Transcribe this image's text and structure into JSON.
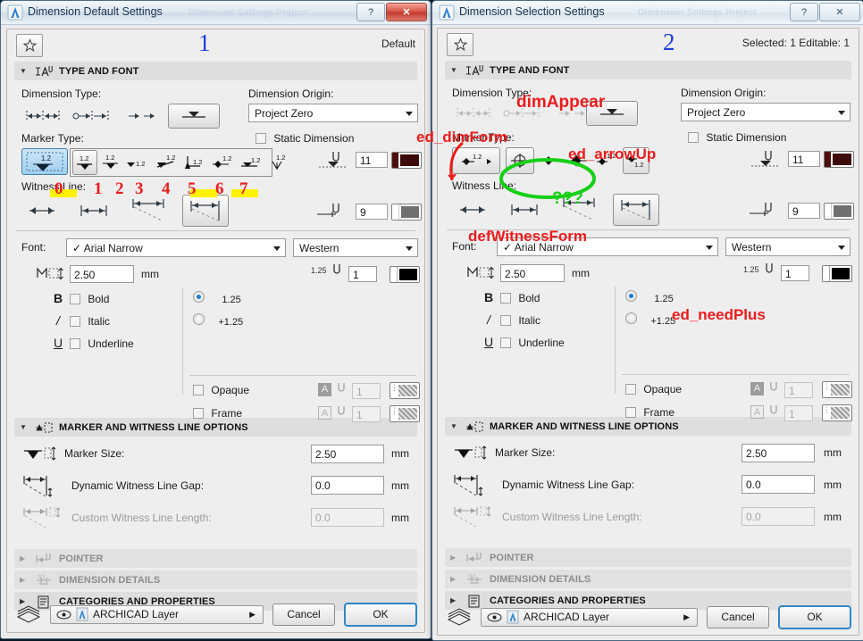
{
  "window1": {
    "title": "Dimension Default Settings",
    "ghost_title": "Dimension  Settings  Project",
    "help_btn": "?",
    "close_btn": "✕",
    "badge_number": "1",
    "status_right": "Default",
    "favorites_icon": "star-icon",
    "sections": {
      "type_and_font": "TYPE AND FONT",
      "marker_options": "MARKER AND WITNESS LINE OPTIONS",
      "pointer": "POINTER",
      "dimension_details": "DIMENSION DETAILS",
      "categories": "CATEGORIES AND PROPERTIES"
    },
    "labels": {
      "dimension_type": "Dimension Type:",
      "dimension_origin": "Dimension Origin:",
      "marker_type": "Marker Type:",
      "witness_line": "Witness Line:",
      "static_dimension": "Static Dimension",
      "font": "Font:",
      "bold": "Bold",
      "italic": "Italic",
      "underline": "Underline",
      "opaque": "Opaque",
      "frame": "Frame",
      "marker_size": "Marker Size:",
      "dynamic_gap": "Dynamic Witness Line Gap:",
      "custom_length": "Custom Witness Line Length:",
      "mm": "mm"
    },
    "values": {
      "dimension_origin": "Project Zero",
      "marker_pen": "11",
      "witness_pen": "9",
      "font_name": "Arial Narrow",
      "font_script": "Western",
      "font_size": "2.50",
      "font_pen": "1",
      "radio_plain": "1.25",
      "radio_plus": "+1.25",
      "opaque_pen": "1",
      "frame_pen": "1",
      "marker_size": "2.50",
      "dynamic_gap": "0.0",
      "custom_length": "0.0",
      "sup_125": "1.25"
    },
    "footer": {
      "layer": "ARCHICAD Layer",
      "cancel": "Cancel",
      "ok": "OK"
    },
    "annotations": {
      "marker_numbers": [
        "0",
        "1",
        "2",
        "3",
        "4",
        "5",
        "6",
        "7"
      ],
      "highlight_color": "#fff200",
      "number_color": "#ee1b1b"
    }
  },
  "window2": {
    "title": "Dimension Selection Settings",
    "ghost_title": "Dimension  Settings  Project",
    "help_btn": "?",
    "close_btn": "✕",
    "badge_number": "2",
    "status_right": "Selected: 1 Editable: 1",
    "favorites_icon": "star-icon",
    "sections": {
      "type_and_font": "TYPE AND FONT",
      "marker_options": "MARKER AND WITNESS LINE OPTIONS",
      "pointer": "POINTER",
      "dimension_details": "DIMENSION DETAILS",
      "categories": "CATEGORIES AND PROPERTIES"
    },
    "labels": {
      "dimension_type": "Dimension Type:",
      "dimension_origin": "Dimension Origin:",
      "marker_type": "Marker Type:",
      "witness_line": "Witness Line:",
      "static_dimension": "Static Dimension",
      "font": "Font:",
      "bold": "Bold",
      "italic": "Italic",
      "underline": "Underline",
      "opaque": "Opaque",
      "frame": "Frame",
      "marker_size": "Marker Size:",
      "dynamic_gap": "Dynamic Witness Line Gap:",
      "custom_length": "Custom Witness Line Length:",
      "mm": "mm"
    },
    "values": {
      "dimension_origin": "Project Zero",
      "marker_pen": "11",
      "witness_pen": "9",
      "font_name": "Arial Narrow",
      "font_script": "Western",
      "font_size": "2.50",
      "font_pen": "1",
      "radio_plain": "1.25",
      "radio_plus": "+1.25",
      "opaque_pen": "1",
      "frame_pen": "1",
      "marker_size": "2.50",
      "dynamic_gap": "0.0",
      "custom_length": "0.0",
      "sup_125": "1.25"
    },
    "footer": {
      "layer": "ARCHICAD Layer",
      "cancel": "Cancel",
      "ok": "OK"
    },
    "annotations": {
      "dim_appear": "dimAppear",
      "ed_dim_form": "ed_dimForm",
      "ed_arrow_up": "ed_arrowUp",
      "question_marks": "???",
      "def_witness_form": "defWitnessForm",
      "ed_need_plus": "ed_needPlus",
      "red_color": "#ee1b1b",
      "green_color": "#16cf16"
    }
  }
}
